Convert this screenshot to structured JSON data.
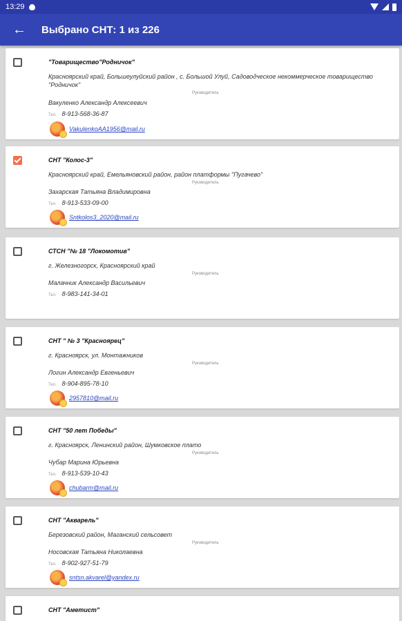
{
  "status_bar": {
    "time": "13:29"
  },
  "header": {
    "title": "Выбрано СНТ: 1 из 226"
  },
  "common": {
    "role_label": "Руководитель",
    "tel_label": "Тел."
  },
  "cards": [
    {
      "name": "\"Товарищество\"Родничок\"",
      "address": "Красноярский край, Большеулуйский район , с. Большой Улуй, Садоводческое некоммерческое товарищество \"Родничок\"",
      "person": "Вакуленко Александр Алексеевич",
      "phone": "8-913-568-36-87",
      "email": "VakulenkoAA1956@mail.ru",
      "checked": false
    },
    {
      "name": "СНТ \"Колос-3\"",
      "address": "Красноярский край, Емельяновский район, район платформы \"Пугачево\"",
      "person": "Захарская Татьяна Владимировна",
      "phone": "8-913-533-09-00",
      "email": "Sntkolos3_2020@mail.ru",
      "checked": true
    },
    {
      "name": "СТСН \"№ 18 \"Локомотив\"",
      "address": "г. Железногорск, Красноярский край",
      "person": "Малачник Александр Васильевич",
      "phone": "8-983-141-34-01",
      "email": "",
      "checked": false
    },
    {
      "name": "СНТ \" № 3 \"Красноярец\"",
      "address": "г. Красноярск, ул. Монтажников",
      "person": "Логин Александр Евгеньевич",
      "phone": "8-904-895-78-10",
      "email": "2957810@mail.ru",
      "checked": false
    },
    {
      "name": "СНТ \"50 лет Победы\"",
      "address": "г. Красноярск, Ленинский район, Шумковское плато",
      "person": "Чубар Марина Юрьевна",
      "phone": "8-913-539-10-43",
      "email": "chubarm@mail.ru",
      "checked": false
    },
    {
      "name": "СНТ \"Акварель\"",
      "address": "Березовский район, Маганский сельсовет",
      "person": "Носовская Татьяна Николаевна",
      "phone": "8-902-927-51-79",
      "email": "sntsn.akvarel@yandex.ru",
      "checked": false
    },
    {
      "name": "СНТ \"Аметист\"",
      "address": "",
      "person": "",
      "phone": "",
      "email": "",
      "checked": false
    }
  ]
}
